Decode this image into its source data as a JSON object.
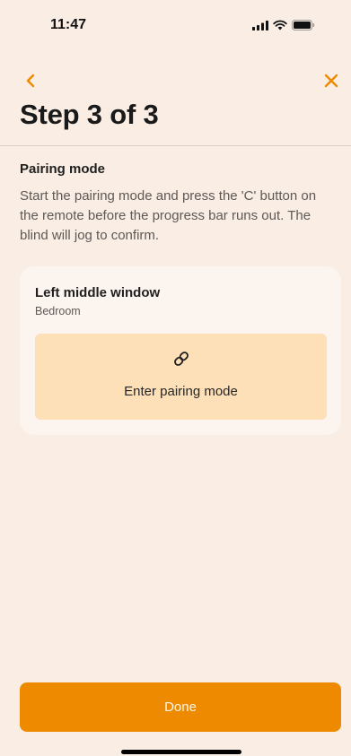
{
  "status_bar": {
    "time": "11:47",
    "icons": [
      "cellular-signal-icon",
      "wifi-icon",
      "battery-icon"
    ]
  },
  "nav": {
    "back_icon": "chevron-left-icon",
    "close_icon": "close-icon"
  },
  "page": {
    "title": "Step 3 of 3"
  },
  "section": {
    "title": "Pairing mode",
    "description": "Start the pairing mode and press the 'C' button on the remote before the progress bar runs out. The blind will jog to confirm."
  },
  "device": {
    "name": "Left middle window",
    "room": "Bedroom",
    "pairing_button": {
      "icon": "link-icon",
      "label": "Enter pairing mode"
    }
  },
  "footer": {
    "done_label": "Done"
  },
  "colors": {
    "accent": "#ee8a00",
    "background": "#f9ede4",
    "card": "#fcf4ef",
    "pairing_button_bg": "#fde0b7"
  }
}
